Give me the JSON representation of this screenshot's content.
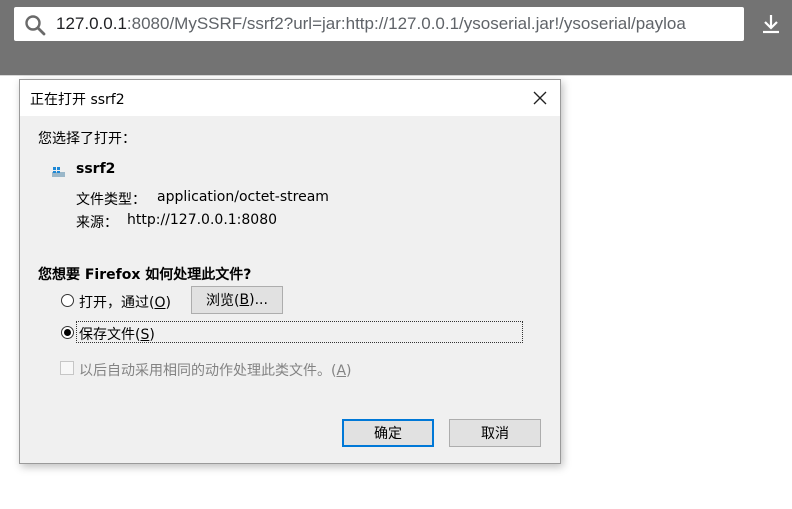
{
  "browser": {
    "url_host": "127.0.0.1",
    "url_rest": ":8080/MySSRF/ssrf2?url=jar:http://127.0.0.1/ysoserial.jar!/ysoserial/payloa"
  },
  "dialog": {
    "title": "正在打开 ssrf2",
    "intro": "您选择了打开：",
    "file_name": "ssrf2",
    "type_label": "文件类型：",
    "type_value": "application/octet-stream",
    "source_label": "来源：",
    "source_value": "http://127.0.0.1:8080",
    "question": "您想要 Firefox 如何处理此文件?",
    "open_with_label": "打开，通过(",
    "open_with_key": "O",
    "open_with_end": ")",
    "browse_label": "浏览(",
    "browse_key": "B",
    "browse_end": ")...",
    "save_label": "保存文件(",
    "save_key": "S",
    "save_end": ")",
    "auto_label": "以后自动采用相同的动作处理此类文件。(",
    "auto_key": "A",
    "auto_end": ")",
    "ok_label": "确定",
    "cancel_label": "取消"
  }
}
